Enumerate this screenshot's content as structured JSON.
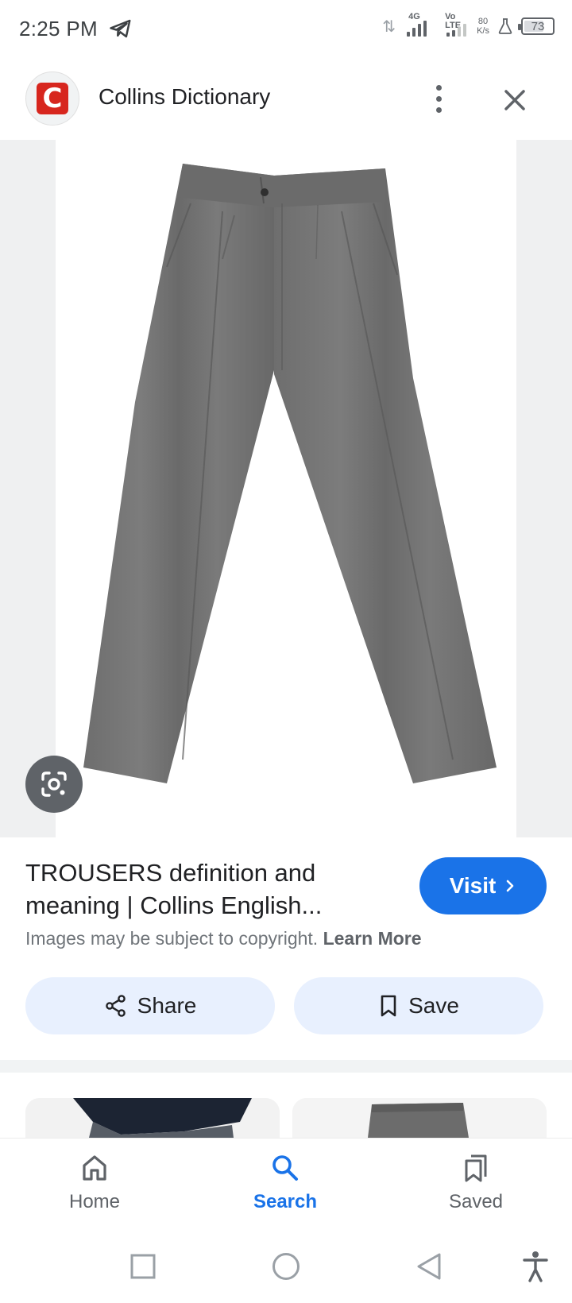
{
  "status_bar": {
    "time": "2:25 PM",
    "network_4g": "4G",
    "network_volte": "Vo LTE",
    "speed_value": "80",
    "speed_unit": "K/s",
    "battery": "73",
    "battery_level": 0.73
  },
  "header": {
    "site_logo_letter": "C",
    "site_name": "Collins Dictionary"
  },
  "result": {
    "title": "TROUSERS definition and meaning | Collins English...",
    "visit_label": "Visit",
    "copyright_text": "Images may be subject to copyright.",
    "learn_more": "Learn More",
    "share_label": "Share",
    "save_label": "Save"
  },
  "bottom_nav": {
    "items": [
      {
        "label": "Home",
        "icon": "home-icon"
      },
      {
        "label": "Search",
        "icon": "search-icon"
      },
      {
        "label": "Saved",
        "icon": "saved-icon"
      }
    ],
    "active": "Search"
  },
  "colors": {
    "accent": "#1a73e8",
    "chip_bg": "#e8f0fe",
    "brand_red": "#d7261e"
  }
}
